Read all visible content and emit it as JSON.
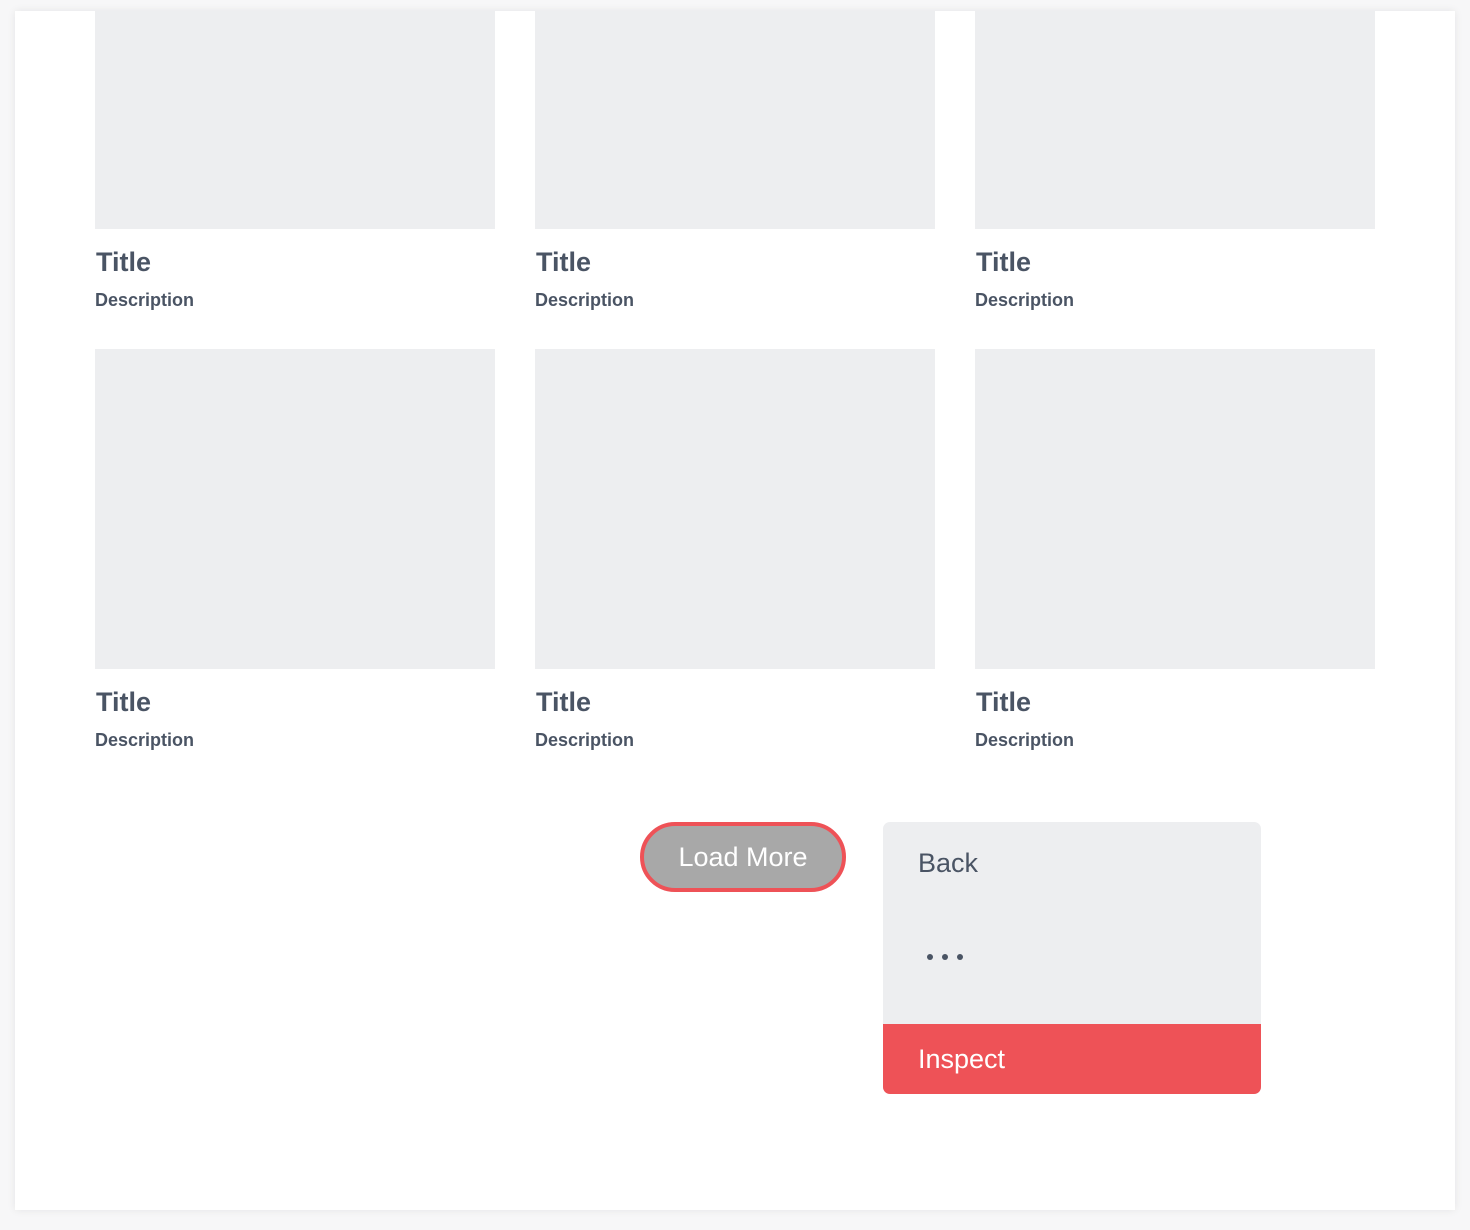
{
  "cards": [
    {
      "title": "Title",
      "description": "Description"
    },
    {
      "title": "Title",
      "description": "Description"
    },
    {
      "title": "Title",
      "description": "Description"
    },
    {
      "title": "Title",
      "description": "Description"
    },
    {
      "title": "Title",
      "description": "Description"
    },
    {
      "title": "Title",
      "description": "Description"
    }
  ],
  "load_more": {
    "label": "Load More"
  },
  "context_menu": {
    "back_label": "Back",
    "inspect_label": "Inspect"
  },
  "colors": {
    "accent": "#ee5257",
    "placeholder": "#edeef0",
    "text": "#4a5464",
    "button_fill": "#a8a8a8"
  }
}
